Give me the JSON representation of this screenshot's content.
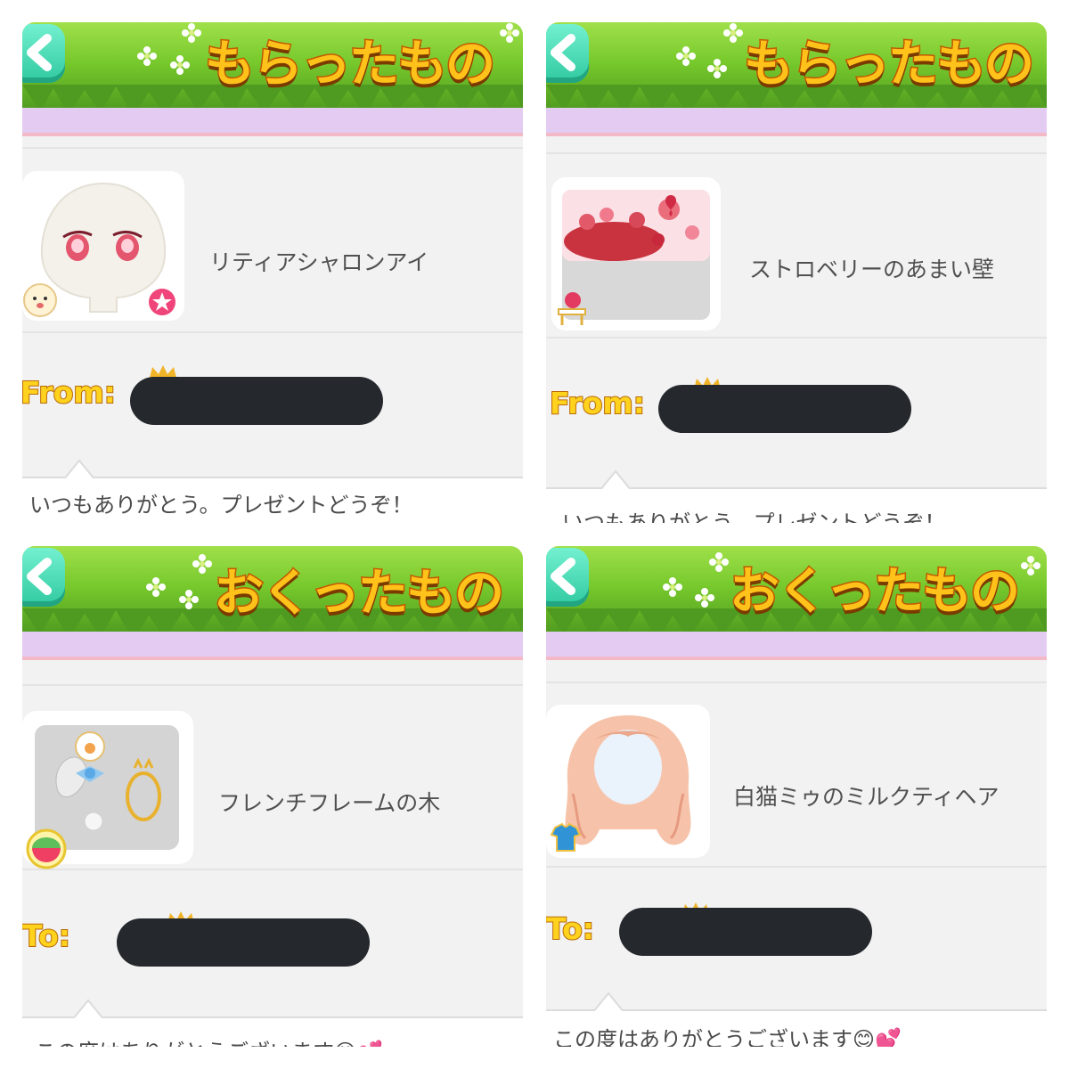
{
  "panels": [
    {
      "title": "もらったもの",
      "direction_label": "From:",
      "item_name": "リティアシャロンアイ",
      "item_icon": "eyes-icon",
      "category_icon": "face-icon",
      "message": "いつもありがとう。プレゼントどうぞ！"
    },
    {
      "title": "もらったもの",
      "direction_label": "From:",
      "item_name": "ストロベリーのあまい壁",
      "item_icon": "strawberry-wall-icon",
      "category_icon": "furniture-icon",
      "message": "いつもありがとう。プレゼントどうぞ！"
    },
    {
      "title": "おくったもの",
      "direction_label": "To:",
      "item_name": "フレンチフレームの木",
      "item_icon": "french-frame-tree-icon",
      "category_icon": "background-icon",
      "message": "この度はありがとうございます😊💕"
    },
    {
      "title": "おくったもの",
      "direction_label": "To:",
      "item_name": "白猫ミゥのミルクティヘア",
      "item_icon": "hair-icon",
      "category_icon": "clothing-icon",
      "message": "この度はありがとうございます😊💕"
    }
  ],
  "colors": {
    "grass": "#77c92c",
    "lavender": "#e3cbf2",
    "title_fill": "#ffc21a",
    "back_button": "#2fc9a0",
    "redaction": "#25292d"
  }
}
